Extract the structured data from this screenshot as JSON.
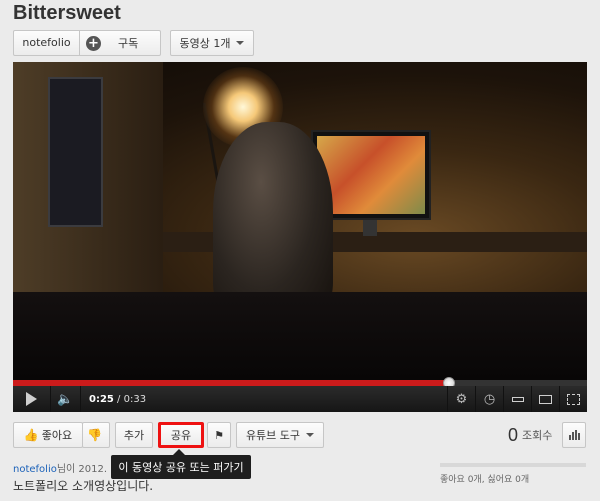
{
  "video": {
    "title": "Bittersweet",
    "channel": "notefolio",
    "subscribe_label": "구독",
    "videos_label": "동영상 1개"
  },
  "player": {
    "current_time": "0:25",
    "separator": " / ",
    "duration": "0:33",
    "progress": 0.76
  },
  "actions": {
    "like_label": "좋아요",
    "add_label": "추가",
    "share_label": "공유",
    "tools_label": "유튜브 도구",
    "share_tooltip": "이 동영상 공유 또는 퍼가기"
  },
  "stats": {
    "views": "0",
    "views_label": "조회수",
    "likes_summary": "좋아요 0개, 싫어요 0개"
  },
  "meta": {
    "uploader": "notefolio",
    "upload_text": "님이 2012. 1",
    "description": "노트폴리오 소개영상입니다."
  },
  "colors": {
    "accent": "#cc1b1b",
    "highlight": "#ee1111"
  }
}
